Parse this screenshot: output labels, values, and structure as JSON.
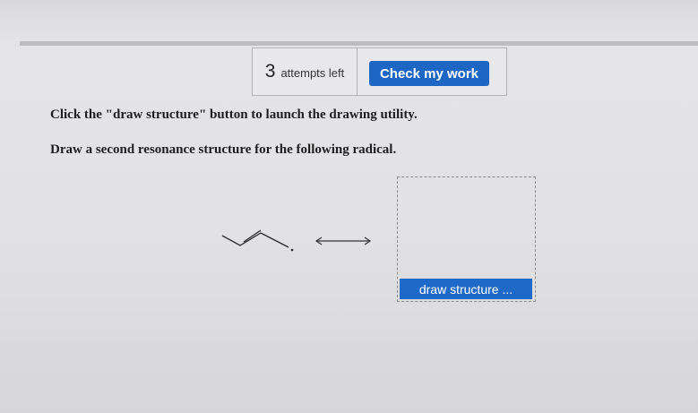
{
  "attempts": {
    "count": "3",
    "label": "attempts left"
  },
  "actions": {
    "check_label": "Check my work",
    "draw_label": "draw structure ..."
  },
  "instructions": [
    "Click the \"draw structure\" button to launch the drawing utility.",
    "Draw a second resonance structure for the following radical."
  ],
  "colors": {
    "primary_button": "#1d66c4",
    "background": "#e2e2e4"
  },
  "icons": {
    "molecule": "allyl-radical-structure",
    "resonance": "double-headed-arrow"
  }
}
